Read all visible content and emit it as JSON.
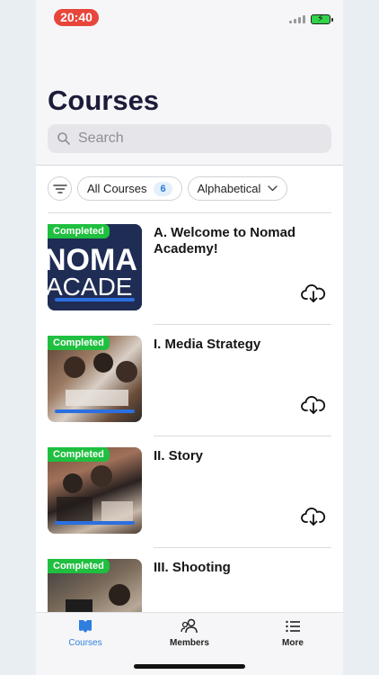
{
  "status_bar": {
    "time": "20:40"
  },
  "header": {
    "title": "Courses"
  },
  "search": {
    "placeholder": "Search"
  },
  "filters": {
    "all_courses_label": "All Courses",
    "all_courses_count": "6",
    "sort_label": "Alphabetical"
  },
  "courses": [
    {
      "badge": "Completed",
      "title": "A. Welcome to Nomad Academy!",
      "thumb_text": "OMA\nACADE",
      "progress": 1.0
    },
    {
      "badge": "Completed",
      "title": "I. Media Strategy",
      "progress": 1.0
    },
    {
      "badge": "Completed",
      "title": "II. Story",
      "progress": 1.0
    },
    {
      "badge": "Completed",
      "title": "III. Shooting",
      "progress": 1.0
    }
  ],
  "tabbar": {
    "courses": "Courses",
    "members": "Members",
    "more": "More"
  },
  "colors": {
    "accent": "#2f7ee0",
    "completed": "#1fbf3f",
    "time_pill": "#e8463b"
  }
}
